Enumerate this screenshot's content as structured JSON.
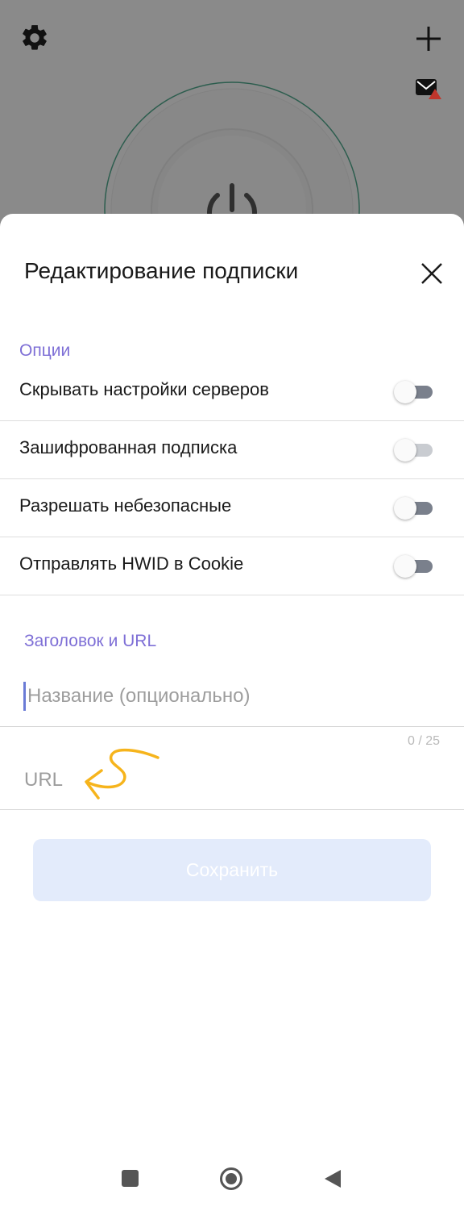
{
  "background": {
    "icons": [
      "gear-icon",
      "plus-icon",
      "mail-alert-icon",
      "power-icon"
    ]
  },
  "sheet": {
    "title": "Редактирование подписки",
    "close_icon": "close-icon",
    "options_label": "Опции",
    "options": [
      {
        "label": "Скрывать настройки серверов",
        "enabled": false
      },
      {
        "label": "Зашифрованная подписка",
        "enabled": false
      },
      {
        "label": "Разрешать небезопасные",
        "enabled": false
      },
      {
        "label": "Отправлять HWID в Cookie",
        "enabled": false
      }
    ],
    "title_url_label": "Заголовок и URL",
    "name_placeholder": "Название (опционально)",
    "name_counter": "0 / 25",
    "url_placeholder": "URL",
    "save_label": "Сохранить"
  },
  "navbar": {
    "icons": [
      "recents-icon",
      "home-icon",
      "back-icon"
    ]
  },
  "colors": {
    "accent": "#7e6fd6",
    "annotation_arrow": "#f6b41c",
    "save_button_disabled": "#e3ebfb"
  }
}
